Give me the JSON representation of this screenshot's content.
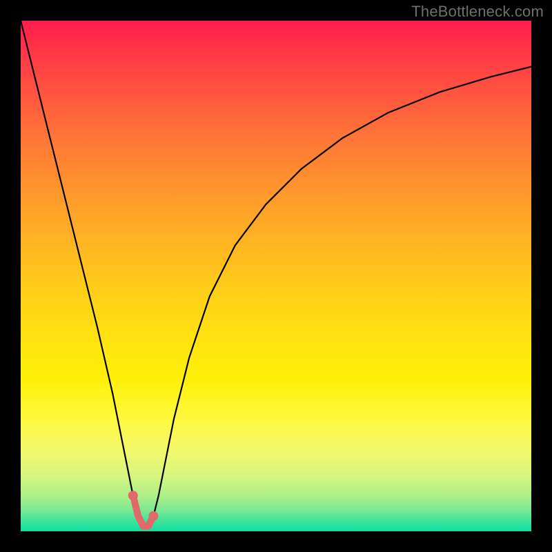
{
  "watermark": "TheBottleneck.com",
  "colors": {
    "frame": "#000000",
    "curve": "#000000",
    "highlight_stroke": "#E06A6A",
    "highlight_fill": "#E06A6A"
  },
  "chart_data": {
    "type": "line",
    "title": "",
    "xlabel": "",
    "ylabel": "",
    "xlim": [
      0,
      100
    ],
    "ylim": [
      0,
      100
    ],
    "grid": false,
    "legend": false,
    "description": "Bottleneck curve: V-shaped valley on a red-to-green vertical gradient. Minimum (green / no bottleneck) near x≈24.",
    "series": [
      {
        "name": "bottleneck-curve",
        "x": [
          0,
          3,
          6,
          9,
          12,
          15,
          18,
          20,
          21,
          22,
          23,
          24,
          25,
          26,
          27,
          28,
          30,
          33,
          37,
          42,
          48,
          55,
          63,
          72,
          82,
          92,
          100
        ],
        "values": [
          100,
          88,
          76,
          64,
          52,
          40,
          27,
          17,
          12,
          7,
          3,
          1,
          1,
          3,
          7,
          12,
          22,
          34,
          46,
          56,
          64,
          71,
          77,
          82,
          86,
          89,
          91
        ]
      }
    ],
    "highlight": {
      "name": "optimal-range",
      "x": [
        22,
        23,
        24,
        25,
        26
      ],
      "values": [
        7,
        3,
        1,
        1,
        3
      ]
    }
  }
}
